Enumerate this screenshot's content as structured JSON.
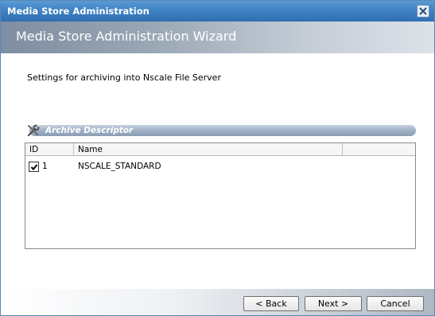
{
  "window": {
    "title": "Media Store Administration"
  },
  "wizard": {
    "title": "Media Store Administration Wizard",
    "subtitle": "Settings for archiving into Nscale File Server"
  },
  "section": {
    "label": "Archive Descriptor",
    "icon": "tools-icon"
  },
  "table": {
    "columns": [
      "ID",
      "Name",
      ""
    ],
    "rows": [
      {
        "checked": true,
        "id": "1",
        "name": "NSCALE_STANDARD"
      }
    ]
  },
  "buttons": {
    "back": "< Back",
    "next": "Next >",
    "cancel": "Cancel"
  },
  "colors": {
    "titlebar": "#3f82c4",
    "banner": "#9aa7b5",
    "section_bar": "#9fb0c4"
  }
}
